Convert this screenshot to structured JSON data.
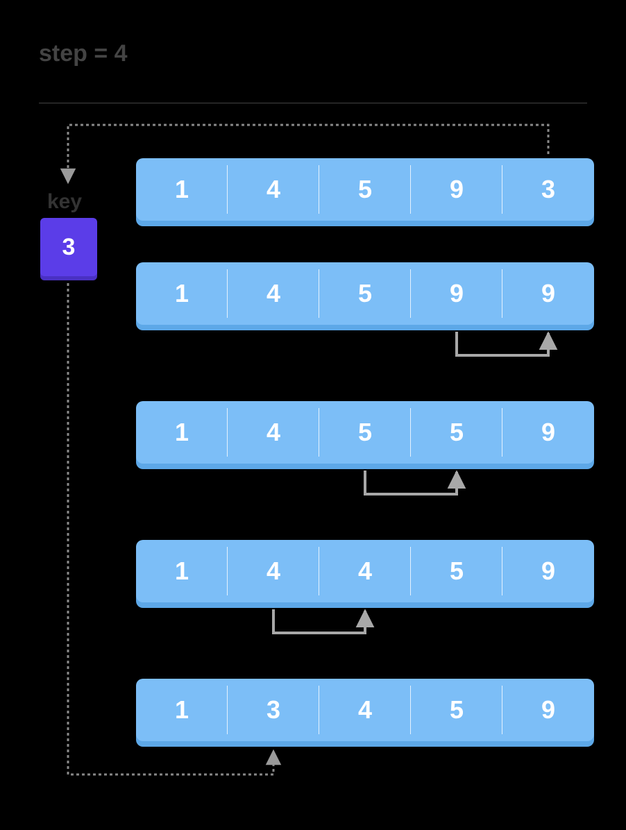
{
  "step_label": "step = 4",
  "key_label": "key",
  "key_value": "3",
  "rows": [
    [
      "1",
      "4",
      "5",
      "9",
      "3"
    ],
    [
      "1",
      "4",
      "5",
      "9",
      "9"
    ],
    [
      "1",
      "4",
      "5",
      "5",
      "9"
    ],
    [
      "1",
      "4",
      "4",
      "5",
      "9"
    ],
    [
      "1",
      "3",
      "4",
      "5",
      "9"
    ]
  ],
  "chart_data": {
    "type": "table",
    "title": "Insertion sort step 4",
    "step": 4,
    "key": 3,
    "iterations": [
      {
        "array": [
          1,
          4,
          5,
          9,
          3
        ],
        "note": "initial, key=3 from index 4"
      },
      {
        "array": [
          1,
          4,
          5,
          9,
          9
        ],
        "shift_from_index": 3,
        "shift_to_index": 4
      },
      {
        "array": [
          1,
          4,
          5,
          5,
          9
        ],
        "shift_from_index": 2,
        "shift_to_index": 3
      },
      {
        "array": [
          1,
          4,
          4,
          5,
          9
        ],
        "shift_from_index": 1,
        "shift_to_index": 2
      },
      {
        "array": [
          1,
          3,
          4,
          5,
          9
        ],
        "insert_key_at_index": 1
      }
    ]
  }
}
